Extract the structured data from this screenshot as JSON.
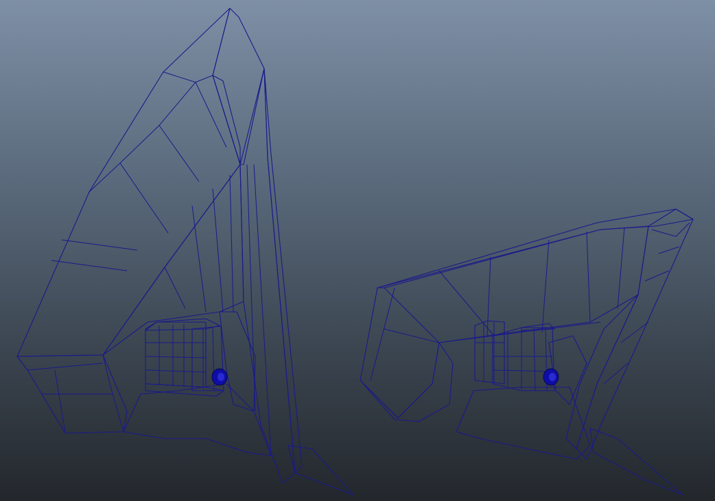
{
  "scene": {
    "background_top": "#7e90a6",
    "background_bottom": "#23272c",
    "wireframe_color": "#1a1a8a",
    "objects": [
      {
        "name": "wing-mesh-left",
        "shading": "gray-lambert-with-wireframe"
      },
      {
        "name": "wing-mesh-right",
        "shading": "gray-lambert-with-wireframe"
      }
    ]
  }
}
